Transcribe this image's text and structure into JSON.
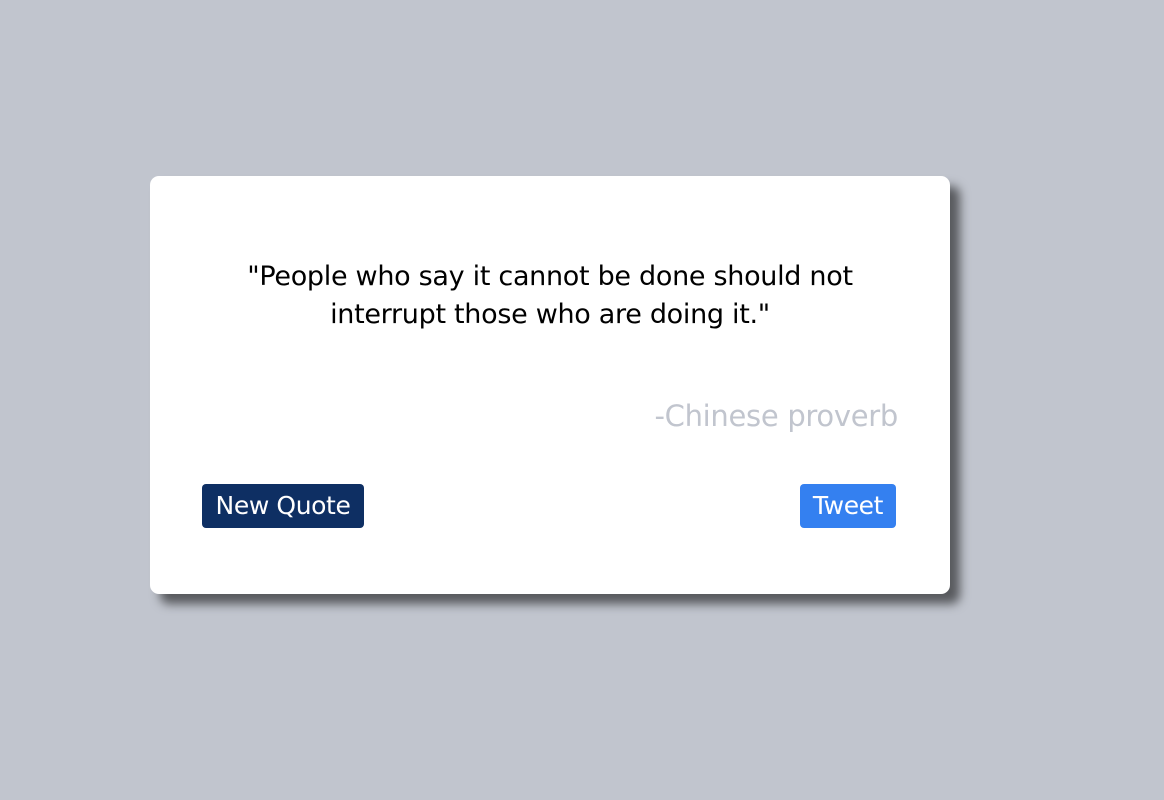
{
  "quote": {
    "text": "\"People who say it cannot be done should not interrupt those who are doing it.\"",
    "author": "-Chinese proverb"
  },
  "buttons": {
    "new_quote_label": "New Quote",
    "tweet_label": "Tweet"
  },
  "colors": {
    "background": "#c1c5ce",
    "card": "#ffffff",
    "new_quote_button": "#0e2f63",
    "tweet_button": "#3480f0",
    "author_text": "#c1c5ce"
  }
}
